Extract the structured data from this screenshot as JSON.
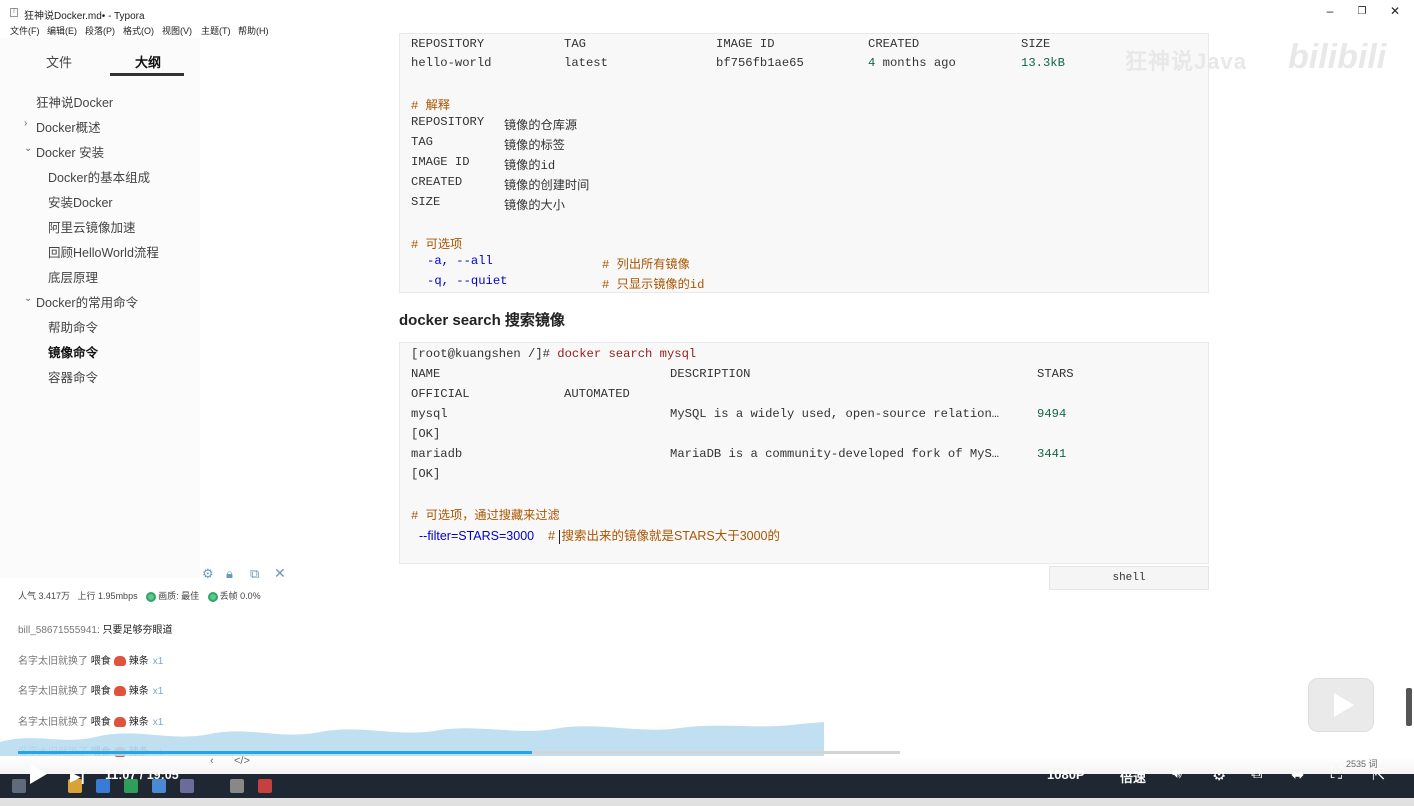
{
  "window": {
    "title": "狂神说Docker.md• - Typora",
    "icon": "T",
    "controls": {
      "minimize": "–",
      "maximize": "❐",
      "close": "✕"
    }
  },
  "menu": [
    "文件(F)",
    "编辑(E)",
    "段落(P)",
    "格式(O)",
    "视图(V)",
    "主题(T)",
    "帮助(H)"
  ],
  "sidebar": {
    "tabs": [
      "文件",
      "大纲"
    ],
    "active_tab": "大纲",
    "outline": [
      {
        "label": "狂神说Docker",
        "level": 0,
        "chevron": ""
      },
      {
        "label": "Docker概述",
        "level": 0,
        "chevron": "›"
      },
      {
        "label": "Docker 安装",
        "level": 0,
        "chevron": "⌄"
      },
      {
        "label": "Docker的基本组成",
        "level": 1,
        "chevron": ""
      },
      {
        "label": "安装Docker",
        "level": 1,
        "chevron": ""
      },
      {
        "label": "阿里云镜像加速",
        "level": 1,
        "chevron": ""
      },
      {
        "label": "回顾HelloWorld流程",
        "level": 1,
        "chevron": ""
      },
      {
        "label": "底层原理",
        "level": 1,
        "chevron": ""
      },
      {
        "label": "Docker的常用命令",
        "level": 0,
        "chevron": "⌄"
      },
      {
        "label": "帮助命令",
        "level": 1,
        "chevron": ""
      },
      {
        "label": "镜像命令",
        "level": 1,
        "chevron": "",
        "active": true
      },
      {
        "label": "容器命令",
        "level": 1,
        "chevron": ""
      }
    ]
  },
  "code1": {
    "header": {
      "repository": "REPOSITORY",
      "tag": "TAG",
      "image_id": "IMAGE ID",
      "created": "CREATED",
      "size": "SIZE"
    },
    "row": {
      "repository": "hello-world",
      "tag": "latest",
      "image_id": "bf756fb1ae65",
      "created_num": "4",
      "created_rest": " months ago",
      "size": "13.3kB"
    },
    "explain_heading": "# 解释",
    "explain": [
      {
        "key": "REPOSITORY",
        "desc": "镜像的仓库源"
      },
      {
        "key": "TAG",
        "desc": "镜像的标签"
      },
      {
        "key": "IMAGE ID",
        "desc": "镜像的id"
      },
      {
        "key": "CREATED",
        "desc": "镜像的创建时间"
      },
      {
        "key": "SIZE",
        "desc": "镜像的大小"
      }
    ],
    "options_heading": "# 可选项",
    "options": [
      {
        "flag": "-a, --all",
        "comment": "# 列出所有镜像"
      },
      {
        "flag": "-q, --quiet",
        "comment": "# 只显示镜像的id"
      }
    ]
  },
  "section_title": "docker search 搜索镜像",
  "code2": {
    "prompt": "[root@kuangshen /]# ",
    "command": "docker search mysql",
    "header": {
      "name": "NAME",
      "description": "DESCRIPTION",
      "stars": "STARS",
      "official": "OFFICIAL",
      "automated": "AUTOMATED"
    },
    "rows": [
      {
        "name": "mysql",
        "description": "MySQL is a widely used, open-source relation…",
        "stars": "9494",
        "status": "[OK]"
      },
      {
        "name": "mariadb",
        "description": "MariaDB is a community-developed fork of MyS…",
        "stars": "3441",
        "status": "[OK]"
      }
    ],
    "filter_heading": "# 可选项，通过搜藏来过滤",
    "filter_prefix": "--",
    "filter_flag": "filter",
    "filter_eq": "=STARS=3000",
    "filter_comment_hash": "# ",
    "filter_comment": "搜索出来的镜像就是STARS大于3000的",
    "language": "shell"
  },
  "watermark": {
    "text": "狂神说Java",
    "logo": "bilibili"
  },
  "live": {
    "stats": {
      "popularity": "人气 3.417万",
      "upload": "上行 1.95mbps",
      "quality": "画质: 最佳",
      "drop": "丢帧 0.0%"
    },
    "chat": [
      {
        "user": "bill_58671555941",
        "sep": ": ",
        "text": "只要足够夯眼道",
        "gift": "",
        "count": ""
      },
      {
        "user": "名字太旧就换了",
        "sep": " ",
        "text": "",
        "gift": "喂食",
        "item": "辣条",
        "count": "x1"
      },
      {
        "user": "名字太旧就换了",
        "sep": " ",
        "text": "",
        "gift": "喂食",
        "item": "辣条",
        "count": "x1"
      },
      {
        "user": "名字太旧就换了",
        "sep": " ",
        "text": "",
        "gift": "喂食",
        "item": "辣条",
        "count": "x1"
      },
      {
        "user": "名字太旧就换了",
        "sep": " ",
        "text": "",
        "gift": "喂食",
        "item": "辣条",
        "count": "x1"
      }
    ]
  },
  "player": {
    "time": "11:07 / 19:05",
    "progress": 0.583,
    "quality": "1080P",
    "speed": "倍速",
    "word_count": "2535 词"
  },
  "colors": {
    "comment": "#aa5500",
    "number": "#116644",
    "keyword": "#0000cc",
    "progress": "#22a6e6"
  }
}
